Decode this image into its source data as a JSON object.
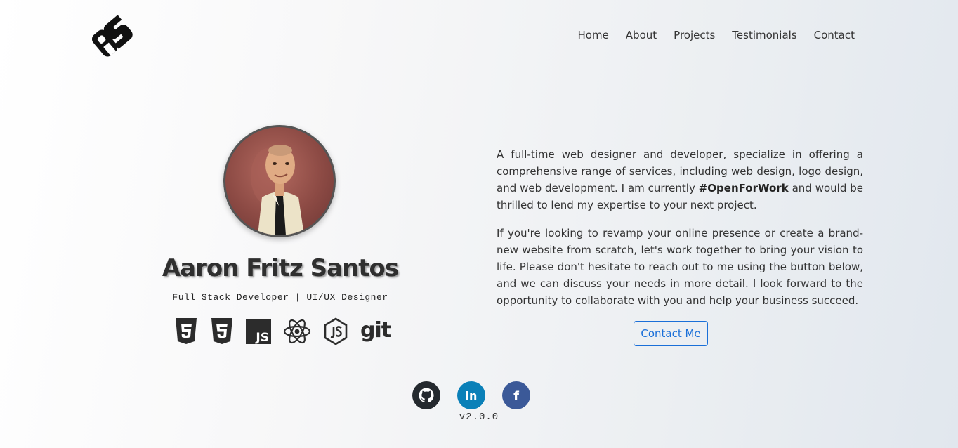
{
  "nav": {
    "items": [
      "Home",
      "About",
      "Projects",
      "Testimonials",
      "Contact"
    ]
  },
  "logo": {
    "icon": "ps-monogram-logo"
  },
  "profile": {
    "name": "Aaron Fritz Santos",
    "title": "Full Stack Developer | UI/UX Designer",
    "avatar_icon": "profile-portrait"
  },
  "tech_stack": [
    {
      "icon": "html5-icon"
    },
    {
      "icon": "css3-icon"
    },
    {
      "icon": "javascript-icon",
      "text": "JS"
    },
    {
      "icon": "react-icon"
    },
    {
      "icon": "nodejs-icon"
    },
    {
      "icon": "git-icon",
      "text": "git"
    }
  ],
  "about": {
    "p1_before": "A full-time web designer and developer, specialize in offering a comprehensive range of services, including web design, logo design, and web development. I am currently ",
    "p1_bold": "#OpenForWork",
    "p1_after": " and would be thrilled to lend my expertise to your next project.",
    "p2": "If you're looking to revamp your online presence or create a brand-new website from scratch, let's work together to bring your vision to life. Please don't hesitate to reach out to me using the button below, and we can discuss your needs in more detail. I look forward to the opportunity to collaborate with you and help your business succeed."
  },
  "contact_button": "Contact Me",
  "socials": [
    {
      "icon": "github-icon",
      "color": "#24292e"
    },
    {
      "icon": "linkedin-icon",
      "color": "#0a80b8",
      "text": "in"
    },
    {
      "icon": "facebook-icon",
      "color": "#3b5998",
      "text": "f"
    }
  ],
  "version": "v2.0.0",
  "colors": {
    "accent": "#1a6fd8",
    "text": "#333333"
  }
}
